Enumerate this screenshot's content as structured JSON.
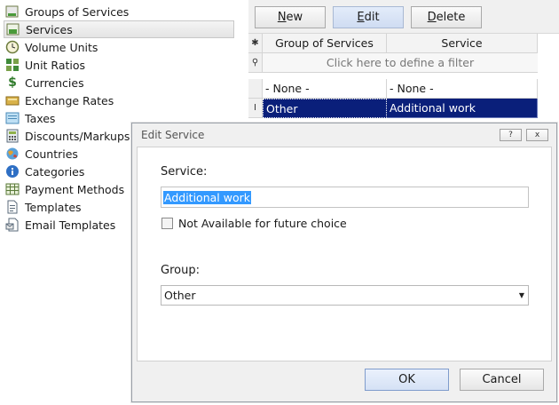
{
  "nav": {
    "items": [
      {
        "label": "Groups of Services",
        "icon": "groups-icon"
      },
      {
        "label": "Services",
        "icon": "services-icon"
      },
      {
        "label": "Volume Units",
        "icon": "clock-icon"
      },
      {
        "label": "Unit Ratios",
        "icon": "unit-ratios-icon"
      },
      {
        "label": "Currencies",
        "icon": "dollar-icon"
      },
      {
        "label": "Exchange Rates",
        "icon": "exchange-icon"
      },
      {
        "label": "Taxes",
        "icon": "taxes-icon"
      },
      {
        "label": "Discounts/Markups",
        "icon": "calculator-icon"
      },
      {
        "label": "Countries",
        "icon": "globe-icon"
      },
      {
        "label": "Categories",
        "icon": "info-icon"
      },
      {
        "label": "Payment Methods",
        "icon": "payment-icon"
      },
      {
        "label": "Templates",
        "icon": "document-icon"
      },
      {
        "label": "Email Templates",
        "icon": "email-template-icon"
      }
    ],
    "selected_index": 1
  },
  "toolbar": {
    "new_label": "New",
    "edit_label": "Edit",
    "delete_label": "Delete"
  },
  "grid": {
    "columns": [
      "Group of Services",
      "Service"
    ],
    "filter_text": "Click here to define a filter",
    "rows": [
      {
        "group": "- None -",
        "service": "- None -"
      },
      {
        "group": "Other",
        "service": "Additional work"
      }
    ]
  },
  "dialog": {
    "title": "Edit Service",
    "help_label": "?",
    "close_label": "x",
    "service_label": "Service:",
    "service_value": "Additional work",
    "checkbox_label": "Not Available for future choice",
    "checkbox_checked": false,
    "group_label": "Group:",
    "group_value": "Other",
    "ok_label": "OK",
    "cancel_label": "Cancel"
  },
  "colors": {
    "selection": "#0a1f7a",
    "text_highlight": "#3399ff"
  }
}
